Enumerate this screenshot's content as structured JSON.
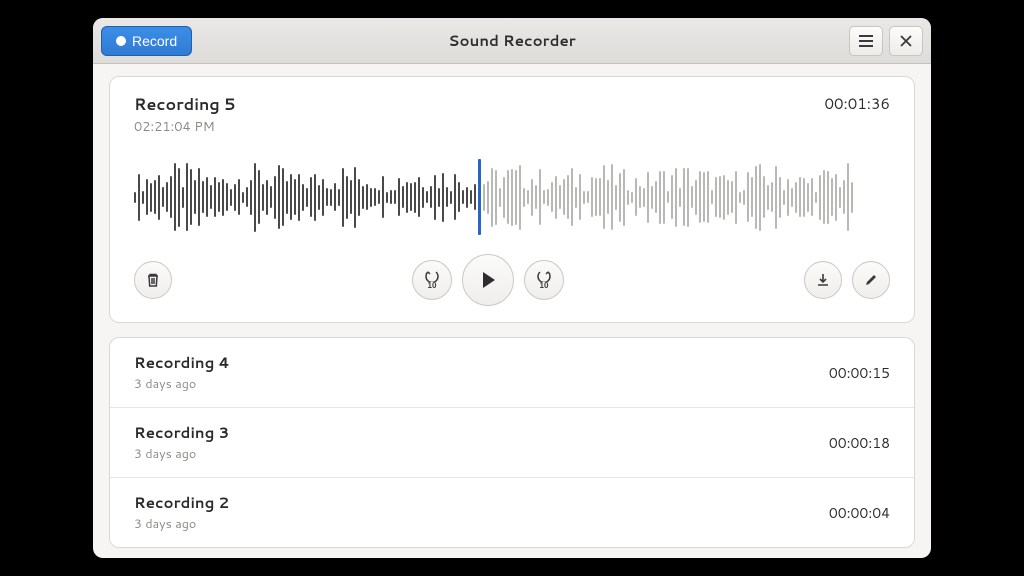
{
  "header": {
    "record_label": "Record",
    "title": "Sound Recorder"
  },
  "active": {
    "title": "Recording 5",
    "timestamp": "02:21:04 PM",
    "duration": "00:01:36",
    "progress": 0.48,
    "waveform_bar_count": 180
  },
  "recordings": [
    {
      "title": "Recording 4",
      "subtitle": "3 days ago",
      "duration": "00:00:15"
    },
    {
      "title": "Recording 3",
      "subtitle": "3 days ago",
      "duration": "00:00:18"
    },
    {
      "title": "Recording 2",
      "subtitle": "3 days ago",
      "duration": "00:00:04"
    }
  ],
  "icons": {
    "skip_back": "10",
    "skip_forward": "10"
  }
}
